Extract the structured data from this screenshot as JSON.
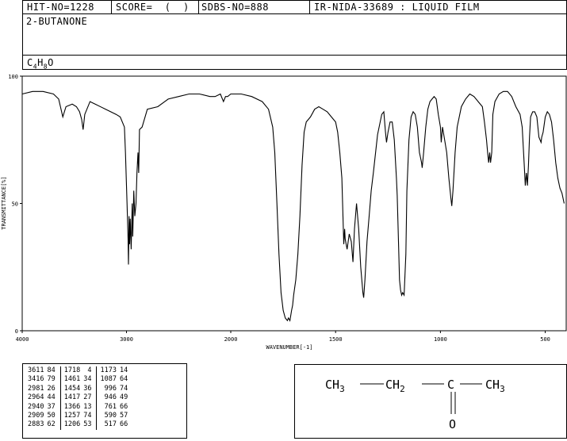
{
  "header": {
    "hit_no": "HIT-NO=1228",
    "score": "SCORE=  (  )",
    "sdbs_no": "SDBS-NO=888",
    "ir_id": "IR-NIDA-33689 : LIQUID FILM",
    "compound": "2-BUTANONE",
    "formula": {
      "c": "C",
      "c_n": "4",
      "h": "H",
      "h_n": "8",
      "o": "O"
    }
  },
  "chart_data": {
    "type": "line",
    "xlabel": "WAVENUMBER[-1]",
    "ylabel": "TRANSMITTANCE[%]",
    "xlim": [
      4000,
      400
    ],
    "ylim": [
      0,
      100
    ],
    "x_ticks": [
      4000,
      3000,
      2000,
      1500,
      1000,
      500
    ],
    "y_ticks": [
      0,
      50,
      100
    ],
    "x": [
      4000,
      3900,
      3800,
      3700,
      3650,
      3611,
      3580,
      3520,
      3480,
      3450,
      3430,
      3416,
      3400,
      3350,
      3300,
      3200,
      3100,
      3060,
      3020,
      3010,
      2995,
      2985,
      2981,
      2975,
      2970,
      2964,
      2955,
      2945,
      2940,
      2930,
      2920,
      2909,
      2900,
      2890,
      2883,
      2875,
      2850,
      2800,
      2700,
      2600,
      2500,
      2400,
      2300,
      2200,
      2150,
      2100,
      2070,
      2050,
      2030,
      2000,
      1950,
      1900,
      1850,
      1820,
      1800,
      1790,
      1780,
      1770,
      1760,
      1750,
      1740,
      1730,
      1725,
      1718,
      1710,
      1705,
      1700,
      1690,
      1680,
      1670,
      1660,
      1650,
      1640,
      1620,
      1600,
      1580,
      1560,
      1540,
      1520,
      1500,
      1490,
      1480,
      1470,
      1461,
      1457,
      1454,
      1445,
      1435,
      1425,
      1417,
      1410,
      1400,
      1390,
      1380,
      1370,
      1366,
      1360,
      1350,
      1340,
      1330,
      1320,
      1300,
      1280,
      1270,
      1262,
      1257,
      1250,
      1240,
      1230,
      1220,
      1210,
      1206,
      1200,
      1195,
      1190,
      1185,
      1180,
      1173,
      1165,
      1160,
      1150,
      1140,
      1130,
      1120,
      1110,
      1100,
      1095,
      1090,
      1087,
      1080,
      1070,
      1060,
      1050,
      1040,
      1030,
      1020,
      1010,
      1000,
      996,
      990,
      980,
      970,
      960,
      950,
      946,
      940,
      930,
      920,
      900,
      880,
      860,
      840,
      820,
      800,
      790,
      780,
      775,
      770,
      765,
      761,
      755,
      750,
      740,
      720,
      700,
      680,
      660,
      640,
      620,
      610,
      600,
      595,
      590,
      585,
      580,
      575,
      570,
      560,
      550,
      540,
      530,
      520,
      517,
      510,
      500,
      490,
      480,
      470,
      460,
      450,
      440,
      430,
      420,
      410,
      400
    ],
    "y": [
      93,
      94,
      94,
      93,
      91,
      84,
      88,
      89,
      88,
      86,
      83,
      79,
      85,
      90,
      89,
      87,
      85,
      84,
      80,
      70,
      50,
      36,
      26,
      45,
      34,
      44,
      32,
      50,
      37,
      55,
      45,
      50,
      62,
      70,
      62,
      79,
      80,
      87,
      88,
      91,
      92,
      93,
      93,
      92,
      92,
      93,
      90,
      92,
      92,
      93,
      93,
      92,
      90,
      87,
      80,
      70,
      50,
      30,
      15,
      8,
      5,
      4,
      5,
      4,
      8,
      10,
      14,
      20,
      30,
      45,
      65,
      78,
      82,
      84,
      87,
      88,
      87,
      86,
      84,
      82,
      78,
      70,
      60,
      34,
      40,
      36,
      32,
      38,
      35,
      27,
      40,
      50,
      40,
      25,
      15,
      13,
      20,
      35,
      45,
      55,
      62,
      77,
      85,
      86,
      78,
      74,
      78,
      82,
      82,
      75,
      60,
      53,
      35,
      20,
      16,
      14,
      15,
      14,
      30,
      55,
      75,
      84,
      86,
      85,
      80,
      70,
      68,
      66,
      64,
      70,
      80,
      87,
      90,
      91,
      92,
      91,
      85,
      80,
      74,
      80,
      75,
      70,
      60,
      52,
      49,
      55,
      70,
      80,
      88,
      91,
      93,
      92,
      90,
      88,
      82,
      75,
      70,
      66,
      70,
      66,
      70,
      85,
      90,
      93,
      94,
      94,
      92,
      88,
      85,
      80,
      65,
      57,
      62,
      57,
      65,
      76,
      84,
      86,
      86,
      84,
      76,
      74,
      76,
      78,
      84,
      86,
      85,
      82,
      75,
      66,
      60,
      56,
      54,
      50
    ]
  },
  "peak_table": {
    "columns": [
      [
        [
          "3611",
          "84"
        ],
        [
          "3416",
          "79"
        ],
        [
          "2981",
          "26"
        ],
        [
          "2964",
          "44"
        ],
        [
          "2940",
          "37"
        ],
        [
          "2909",
          "50"
        ],
        [
          "2883",
          "62"
        ]
      ],
      [
        [
          "1718",
          "4"
        ],
        [
          "1461",
          "34"
        ],
        [
          "1454",
          "36"
        ],
        [
          "1417",
          "27"
        ],
        [
          "1366",
          "13"
        ],
        [
          "1257",
          "74"
        ],
        [
          "1206",
          "53"
        ]
      ],
      [
        [
          "1173",
          "14"
        ],
        [
          "1087",
          "64"
        ],
        [
          "996",
          "74"
        ],
        [
          "946",
          "49"
        ],
        [
          "761",
          "66"
        ],
        [
          "590",
          "57"
        ],
        [
          "517",
          "66"
        ]
      ]
    ]
  },
  "structure": {
    "ch3_a": "CH",
    "ch3_a_sub": "3",
    "ch2": "CH",
    "ch2_sub": "2",
    "c": "C",
    "ch3_b": "CH",
    "ch3_b_sub": "3",
    "o": "O"
  }
}
